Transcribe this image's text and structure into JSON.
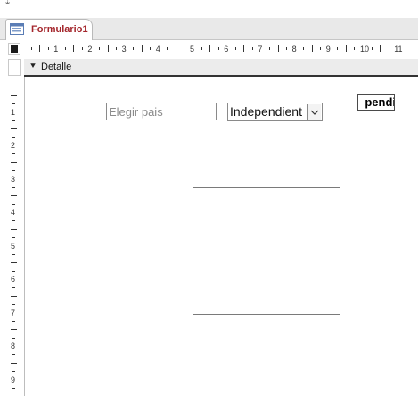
{
  "tab": {
    "label": "Formulario1",
    "icon": "form-icon"
  },
  "ruler": {
    "h_numbers": [
      "1",
      "2",
      "3",
      "4",
      "5",
      "6",
      "7",
      "8",
      "9",
      "10",
      "11"
    ],
    "v_numbers": [
      "1",
      "2",
      "3",
      "4",
      "5",
      "6",
      "7",
      "8",
      "9"
    ]
  },
  "section": {
    "label": "Detalle",
    "icon": "section-arrow-icon"
  },
  "controls": {
    "country_combo": {
      "placeholder": "Elegir pais"
    },
    "type_combo": {
      "value": "Independient"
    },
    "bold_textbox": {
      "value": "pendi"
    }
  },
  "colors": {
    "tab_text": "#a4262c",
    "tabbar_bg": "#e9e9e9",
    "section_bg": "#ececec"
  }
}
